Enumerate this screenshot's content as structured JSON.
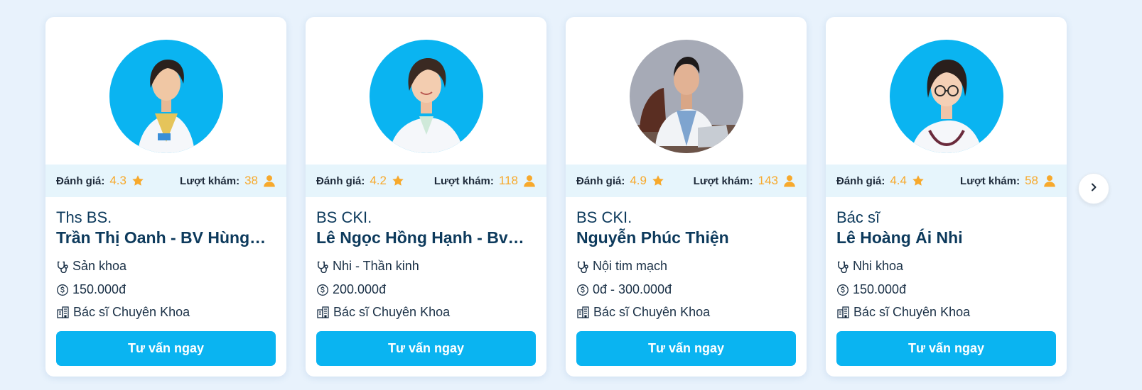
{
  "doctors": [
    {
      "rating_label": "Đánh giá:",
      "rating": "4.3",
      "visits_label": "Lượt khám:",
      "visits": "38",
      "title": "Ths BS.",
      "name": "Trần Thị Oanh - BV Hùng…",
      "specialty": "Sản khoa",
      "price": "150.000đ",
      "type": "Bác sĩ Chuyên Khoa",
      "button": "Tư vấn ngay"
    },
    {
      "rating_label": "Đánh giá:",
      "rating": "4.2",
      "visits_label": "Lượt khám:",
      "visits": "118",
      "title": "BS CKI.",
      "name": "Lê Ngọc Hồng Hạnh - Bv…",
      "specialty": "Nhi - Thần kinh",
      "price": "200.000đ",
      "type": "Bác sĩ Chuyên Khoa",
      "button": "Tư vấn ngay"
    },
    {
      "rating_label": "Đánh giá:",
      "rating": "4.9",
      "visits_label": "Lượt khám:",
      "visits": "143",
      "title": "BS CKI.",
      "name": "Nguyễn Phúc Thiện",
      "specialty": "Nội tim mạch",
      "price": "0đ - 300.000đ",
      "type": "Bác sĩ Chuyên Khoa",
      "button": "Tư vấn ngay"
    },
    {
      "rating_label": "Đánh giá:",
      "rating": "4.4",
      "visits_label": "Lượt khám:",
      "visits": "58",
      "title": "Bác sĩ",
      "name": "Lê Hoàng Ái Nhi",
      "specialty": "Nhi khoa",
      "price": "150.000đ",
      "type": "Bác sĩ Chuyên Khoa",
      "button": "Tư vấn ngay"
    }
  ],
  "icons": {
    "star": "star-icon",
    "person": "person-icon",
    "stethoscope": "stethoscope-icon",
    "money": "dollar-circle-icon",
    "building": "hospital-icon",
    "next": "chevron-right-icon"
  },
  "colors": {
    "accent": "#0ab4f1",
    "rating": "#f7a92c",
    "text_dark": "#0d3a5c",
    "stats_bg": "#e6f5fc",
    "page_bg": "#e8f2fc"
  }
}
